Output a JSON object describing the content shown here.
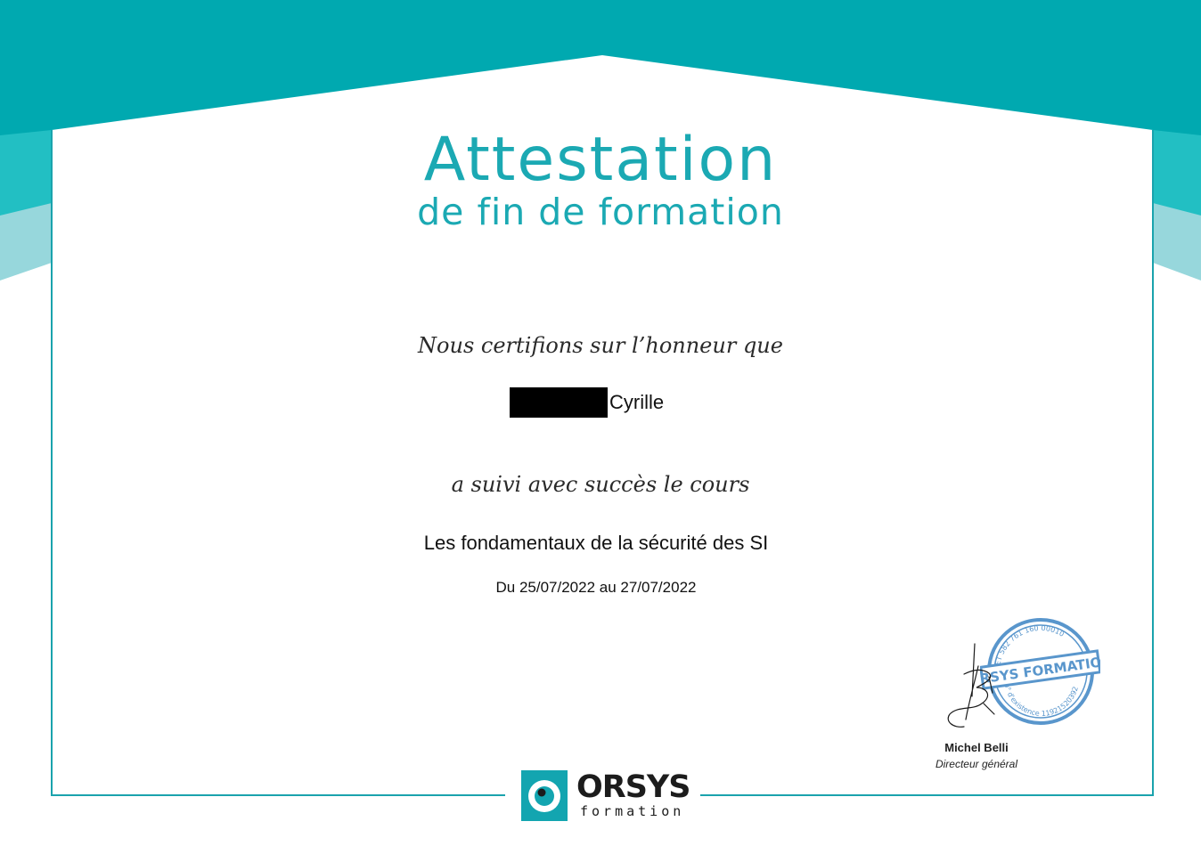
{
  "certificate": {
    "title_main": "Attestation",
    "title_sub": "de fin de formation",
    "certify_text": "Nous certifions sur l’honneur que",
    "recipient_first_name": "Cyrille",
    "followed_text": "a suivi avec succès le cours",
    "course_title": "Les fondamentaux de la sécurité des SI",
    "dates": "Du 25/07/2022 au 27/07/2022"
  },
  "signatory": {
    "name": "Michel Belli",
    "role": "Directeur général"
  },
  "stamp": {
    "brand": "ORSYS FORMATION",
    "siret": "SIRET 582 761 160 00010",
    "existence": "n° d'existence 11921520392"
  },
  "logo": {
    "word": "ORSYS",
    "sub": "formation"
  },
  "colors": {
    "teal_dark": "#00a9b0",
    "teal_mid": "#22bfc3",
    "teal_light": "#97d7dc",
    "title": "#1ba9b3",
    "stamp_blue": "#3d84c4"
  }
}
